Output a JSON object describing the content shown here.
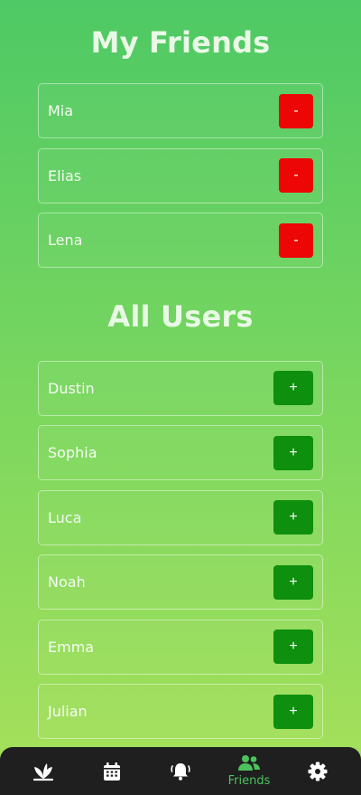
{
  "friends_section": {
    "title": "My Friends",
    "items": [
      {
        "name": "Mia",
        "action": "-"
      },
      {
        "name": "Elias",
        "action": "-"
      },
      {
        "name": "Lena",
        "action": "-"
      }
    ]
  },
  "users_section": {
    "title": "All Users",
    "items": [
      {
        "name": "Dustin",
        "action": "+"
      },
      {
        "name": "Sophia",
        "action": "+"
      },
      {
        "name": "Luca",
        "action": "+"
      },
      {
        "name": "Noah",
        "action": "+"
      },
      {
        "name": "Emma",
        "action": "+"
      },
      {
        "name": "Julian",
        "action": "+"
      }
    ]
  },
  "navbar": {
    "items": [
      {
        "icon": "sprout-icon"
      },
      {
        "icon": "calendar-icon"
      },
      {
        "icon": "bell-icon"
      },
      {
        "icon": "friends-icon",
        "label": "Friends",
        "active": true
      },
      {
        "icon": "gear-icon"
      }
    ]
  },
  "colors": {
    "remove": "#ec0606",
    "add": "#0e8f0e",
    "active_nav": "#4cc25e",
    "navbar_bg": "#1f1f1f"
  }
}
